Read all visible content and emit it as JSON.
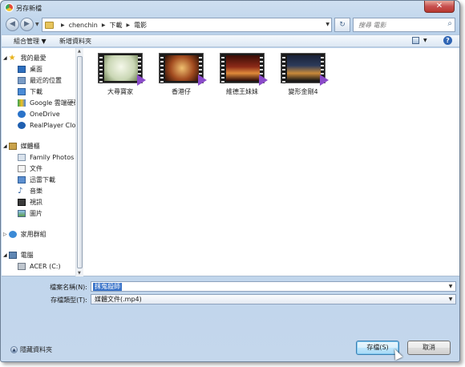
{
  "window": {
    "title": "另存新檔",
    "close_label": "✕"
  },
  "address": {
    "crumbs": [
      "chenchin",
      "下載",
      "電影"
    ]
  },
  "search": {
    "placeholder": "搜尋 電影"
  },
  "toolbar": {
    "organize": "組合管理 ▼",
    "new_folder": "新增資料夾"
  },
  "nav": {
    "favorites": "我的最愛",
    "desktop": "桌面",
    "recent": "最近的位置",
    "downloads": "下載",
    "google_drive": "Google 雲端硬碟",
    "onedrive": "OneDrive",
    "realplayer": "RealPlayer Cloud",
    "libraries": "媒體櫃",
    "family_photos": "Family Photos",
    "documents": "文件",
    "thunder": "迅雷下載",
    "music": "音樂",
    "videos": "視訊",
    "pictures": "圖片",
    "homegroup": "家用群組",
    "computer": "電腦",
    "acer_c": "ACER (C:)"
  },
  "files": [
    {
      "name": "大尋寶家",
      "color": "#c9d6b4"
    },
    {
      "name": "香港仔",
      "color": "#a14a1f"
    },
    {
      "name": "維德王妹妹",
      "color": "#8c2a18"
    },
    {
      "name": "變形金剛4",
      "color": "#2c3a5a"
    }
  ],
  "form": {
    "filename_label": "檔案名稱(N):",
    "filename_value": "抹鬼殺師",
    "filetype_label": "存檔類型(T):",
    "filetype_value": "媒體文件(.mp4)"
  },
  "footer": {
    "hide_folders": "隱藏資料夾",
    "save": "存檔(S)",
    "cancel": "取消"
  }
}
